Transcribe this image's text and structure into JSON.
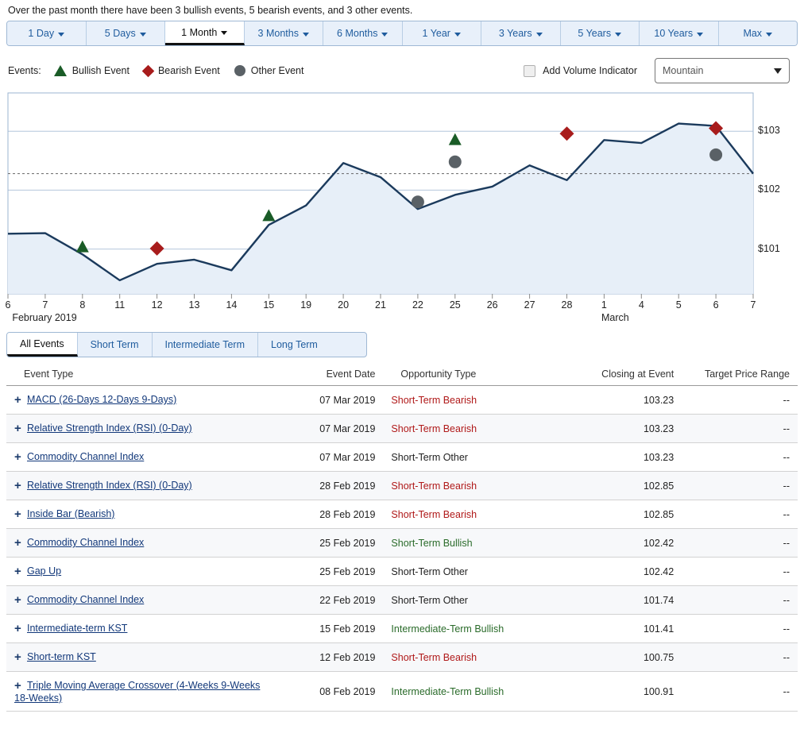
{
  "summary": "Over the past month there have been 3 bullish events, 5 bearish events, and 3 other events.",
  "range_tabs": [
    {
      "label": "1 Day",
      "active": false
    },
    {
      "label": "5 Days",
      "active": false
    },
    {
      "label": "1 Month",
      "active": true
    },
    {
      "label": "3 Months",
      "active": false
    },
    {
      "label": "6 Months",
      "active": false
    },
    {
      "label": "1 Year",
      "active": false
    },
    {
      "label": "3 Years",
      "active": false
    },
    {
      "label": "5 Years",
      "active": false
    },
    {
      "label": "10 Years",
      "active": false
    },
    {
      "label": "Max",
      "active": false
    }
  ],
  "legend": {
    "title": "Events:",
    "items": [
      {
        "label": "Bullish Event",
        "marker": "triangle",
        "color": "#1a5c27"
      },
      {
        "label": "Bearish Event",
        "marker": "diamond",
        "color": "#a81c1c"
      },
      {
        "label": "Other Event",
        "marker": "circle",
        "color": "#5a6166"
      }
    ]
  },
  "controls": {
    "volume_label": "Add Volume Indicator",
    "volume_checked": false,
    "chart_type": "Mountain"
  },
  "term_tabs": [
    {
      "label": "All Events",
      "active": true
    },
    {
      "label": "Short Term",
      "active": false
    },
    {
      "label": "Intermediate Term",
      "active": false
    },
    {
      "label": "Long Term",
      "active": false
    }
  ],
  "table": {
    "headers": [
      "Event Type",
      "Event Date",
      "Opportunity Type",
      "Closing at Event",
      "Target Price Range"
    ],
    "rows": [
      {
        "type": "MACD (26-Days 12-Days 9-Days)",
        "date": "07 Mar 2019",
        "opportunity": "Short-Term Bearish",
        "tone": "bear",
        "closing": "103.23",
        "target": "--"
      },
      {
        "type": "Relative Strength Index (RSI) (0-Day)",
        "date": "07 Mar 2019",
        "opportunity": "Short-Term Bearish",
        "tone": "bear",
        "closing": "103.23",
        "target": "--"
      },
      {
        "type": "Commodity Channel Index",
        "date": "07 Mar 2019",
        "opportunity": "Short-Term Other",
        "tone": "other",
        "closing": "103.23",
        "target": "--"
      },
      {
        "type": "Relative Strength Index (RSI) (0-Day)",
        "date": "28 Feb 2019",
        "opportunity": "Short-Term Bearish",
        "tone": "bear",
        "closing": "102.85",
        "target": "--"
      },
      {
        "type": "Inside Bar (Bearish)",
        "date": "28 Feb 2019",
        "opportunity": "Short-Term Bearish",
        "tone": "bear",
        "closing": "102.85",
        "target": "--"
      },
      {
        "type": "Commodity Channel Index",
        "date": "25 Feb 2019",
        "opportunity": "Short-Term Bullish",
        "tone": "bull",
        "closing": "102.42",
        "target": "--"
      },
      {
        "type": "Gap Up",
        "date": "25 Feb 2019",
        "opportunity": "Short-Term Other",
        "tone": "other",
        "closing": "102.42",
        "target": "--"
      },
      {
        "type": "Commodity Channel Index",
        "date": "22 Feb 2019",
        "opportunity": "Short-Term Other",
        "tone": "other",
        "closing": "101.74",
        "target": "--"
      },
      {
        "type": "Intermediate-term KST",
        "date": "15 Feb 2019",
        "opportunity": "Intermediate-Term Bullish",
        "tone": "bull",
        "closing": "101.41",
        "target": "--"
      },
      {
        "type": "Short-term KST",
        "date": "12 Feb 2019",
        "opportunity": "Short-Term Bearish",
        "tone": "bear",
        "closing": "100.75",
        "target": "--"
      },
      {
        "type": "Triple Moving Average Crossover (4-Weeks 9-Weeks 18-Weeks)",
        "date": "08 Feb 2019",
        "opportunity": "Intermediate-Term Bullish",
        "tone": "bull",
        "closing": "100.91",
        "target": "--"
      }
    ]
  },
  "chart_data": {
    "type": "area",
    "title": "",
    "xlabel": "",
    "ylabel": "",
    "month_labels": [
      {
        "text": "February 2019",
        "x_index": 0
      },
      {
        "text": "March",
        "x_index": 16
      }
    ],
    "categories": [
      "6",
      "7",
      "8",
      "11",
      "12",
      "13",
      "14",
      "15",
      "19",
      "20",
      "21",
      "22",
      "25",
      "26",
      "27",
      "28",
      "1",
      "4",
      "5",
      "6",
      "7"
    ],
    "values": [
      101.26,
      101.27,
      100.91,
      100.47,
      100.75,
      100.82,
      100.64,
      101.41,
      101.74,
      102.46,
      102.22,
      101.68,
      101.92,
      102.06,
      102.42,
      102.17,
      102.85,
      102.8,
      103.13,
      103.09,
      102.28
    ],
    "ylim": [
      100.24,
      103.65
    ],
    "yticks": [
      101,
      102,
      103
    ],
    "ytick_labels": [
      "$101",
      "$102",
      "$103"
    ],
    "grid": true,
    "reference_line": 102.28,
    "legend_position": "top-left",
    "series_color": "#1b3a5c",
    "fill_color": "#e7eff8",
    "markers": [
      {
        "type": "bullish",
        "x_index": 2,
        "value": 101.04,
        "color": "#1a5c27"
      },
      {
        "type": "bearish",
        "x_index": 4,
        "value": 101.01,
        "color": "#a81c1c"
      },
      {
        "type": "bullish",
        "x_index": 7,
        "value": 101.57,
        "color": "#1a5c27"
      },
      {
        "type": "other",
        "x_index": 11,
        "value": 101.8,
        "color": "#5a6166"
      },
      {
        "type": "bullish",
        "x_index": 12,
        "value": 102.86,
        "color": "#1a5c27"
      },
      {
        "type": "other",
        "x_index": 12,
        "value": 102.48,
        "color": "#5a6166"
      },
      {
        "type": "bearish",
        "x_index": 15,
        "value": 102.96,
        "color": "#a81c1c"
      },
      {
        "type": "bearish",
        "x_index": 19,
        "value": 103.05,
        "color": "#a81c1c"
      },
      {
        "type": "other",
        "x_index": 19,
        "value": 102.6,
        "color": "#5a6166"
      }
    ]
  }
}
